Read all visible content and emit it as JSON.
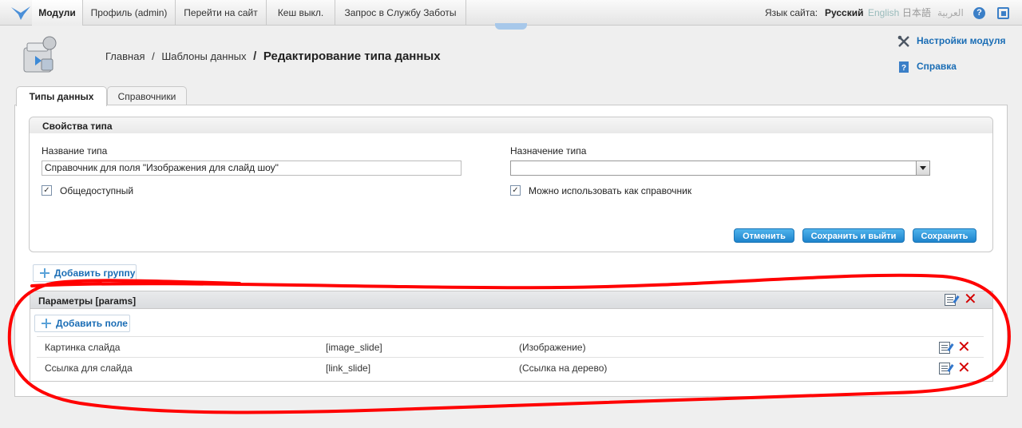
{
  "topbar": {
    "modules": "Модули",
    "profile": "Профиль (admin)",
    "go_to_site": "Перейти на сайт",
    "cache": "Кеш выкл.",
    "support": "Запрос в Службу Заботы",
    "lang_label": "Язык сайта:",
    "languages": [
      "Русский",
      "English",
      "日本語",
      "العربية"
    ]
  },
  "header": {
    "breadcrumb": [
      "Главная",
      "Шаблоны данных"
    ],
    "separator": "/",
    "current": "Редактирование типа данных",
    "module_settings": "Настройки модуля",
    "help": "Справка"
  },
  "tabs": [
    "Типы данных",
    "Справочники"
  ],
  "type_props": {
    "legend": "Свойства типа",
    "name_label": "Название типа",
    "name_value": "Справочник для поля \"Изображения для слайд шоу\"",
    "purpose_label": "Назначение типа",
    "purpose_value": "",
    "public_label": "Общедоступный",
    "public_checked": true,
    "as_reference_label": "Можно использовать как справочник",
    "as_reference_checked": true,
    "cancel": "Отменить",
    "save_exit": "Сохранить и выйти",
    "save": "Сохранить"
  },
  "add_group": "Добавить группу",
  "group": {
    "title": "Параметры [params]",
    "add_field": "Добавить поле",
    "fields": [
      {
        "name": "Картинка слайда",
        "id": "[image_slide]",
        "type": "(Изображение)"
      },
      {
        "name": "Ссылка для слайда",
        "id": "[link_slide]",
        "type": "(Ссылка на дерево)"
      }
    ]
  },
  "colors": {
    "accent": "#1a6db5",
    "delete": "#d40000",
    "annotation": "#ff0000"
  }
}
